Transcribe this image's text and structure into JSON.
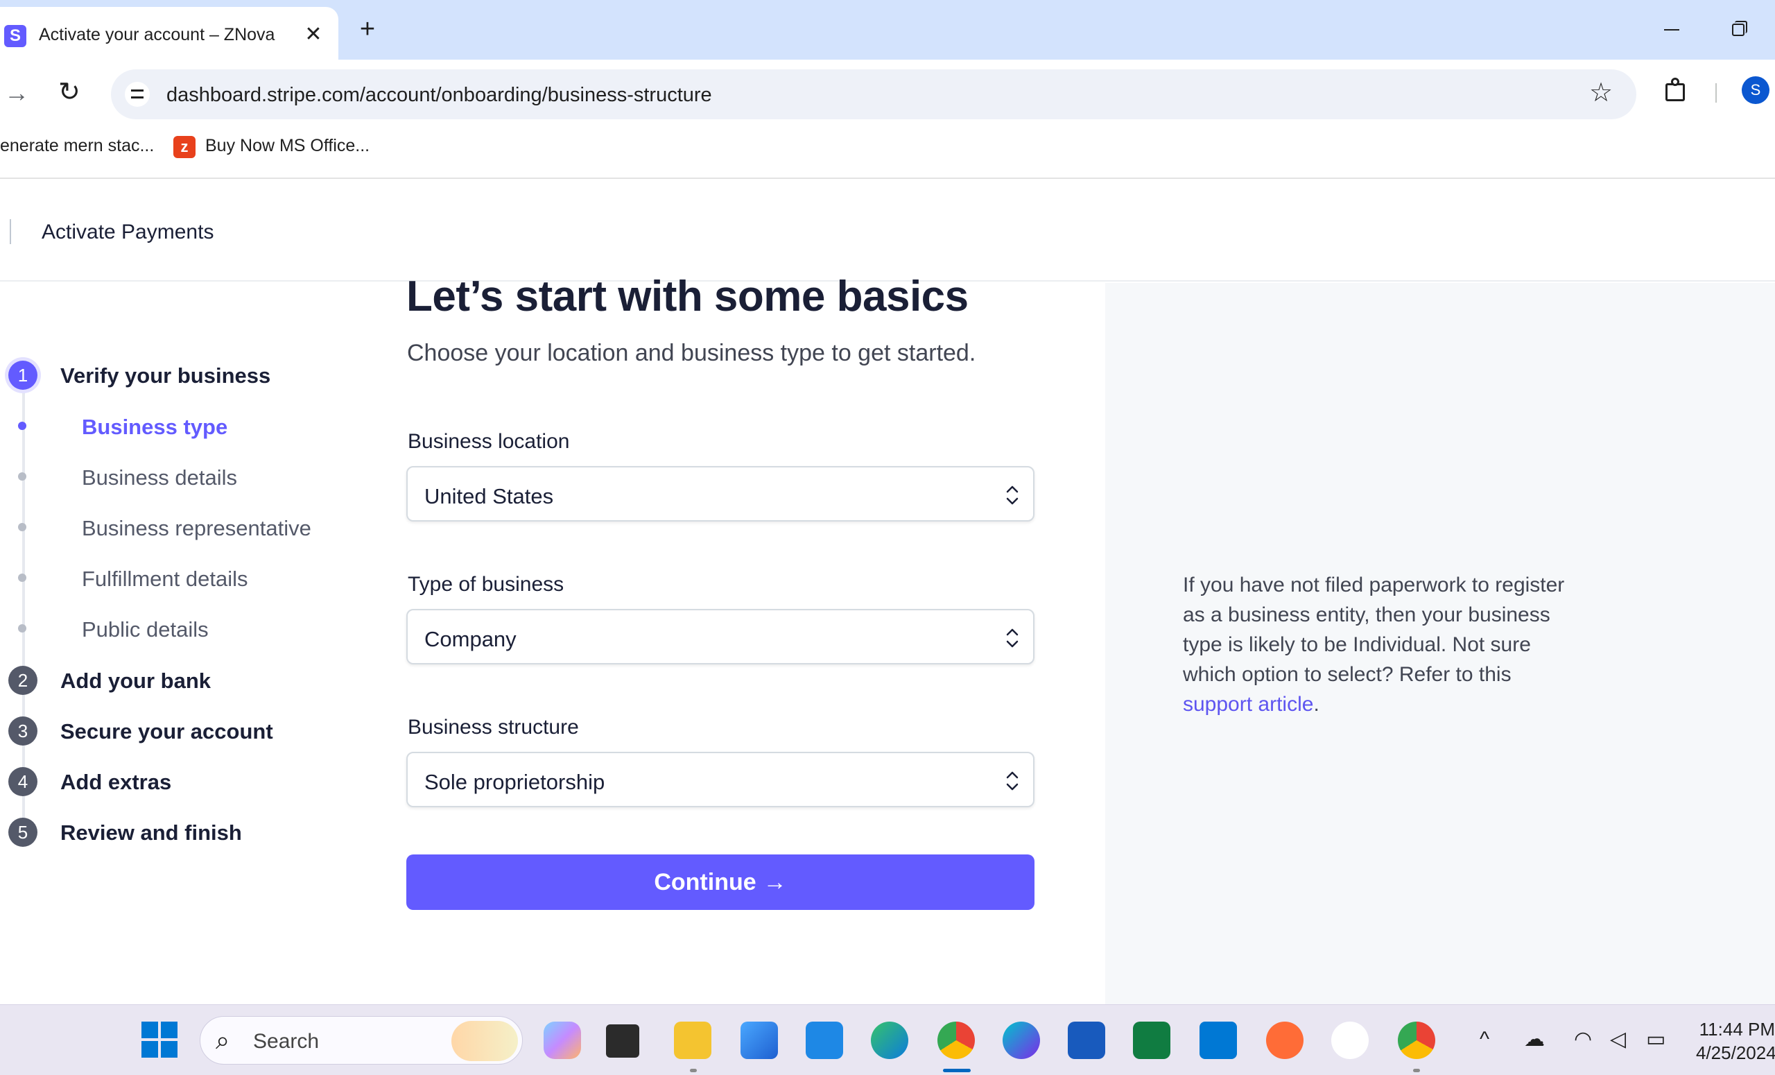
{
  "browser": {
    "tab_title": "Activate your account – ZNova",
    "tab_close": "✕",
    "new_tab": "+",
    "url": "dashboard.stripe.com/account/onboarding/business-structure",
    "bookmarks": [
      "enerate mern stac...",
      "Buy Now MS Office..."
    ],
    "profile_initial": "S"
  },
  "header": {
    "title": "Activate Payments"
  },
  "stepper": {
    "steps": [
      {
        "number": "1",
        "label": "Verify your business",
        "active": true
      },
      {
        "number": "2",
        "label": "Add your bank"
      },
      {
        "number": "3",
        "label": "Secure your account"
      },
      {
        "number": "4",
        "label": "Add extras"
      },
      {
        "number": "5",
        "label": "Review and finish"
      }
    ],
    "substeps": [
      {
        "label": "Business type",
        "active": true
      },
      {
        "label": "Business details"
      },
      {
        "label": "Business representative"
      },
      {
        "label": "Fulfillment details"
      },
      {
        "label": "Public details"
      }
    ]
  },
  "form": {
    "heading": "Let’s start with some basics",
    "subheading": "Choose your location and business type to get started.",
    "location_label": "Business location",
    "location_value": "United States",
    "type_label": "Type of business",
    "type_value": "Company",
    "structure_label": "Business structure",
    "structure_value": "Sole proprietorship",
    "continue_label": "Continue"
  },
  "help": {
    "text": "If you have not filed paperwork to register as a business entity, then your business type is likely to be Individual. Not sure which option to select? Refer to this ",
    "link": "support article",
    "end": "."
  },
  "taskbar": {
    "search_placeholder": "Search",
    "time": "11:44 PM",
    "date": "4/25/2024"
  },
  "colors": {
    "accent": "#635bff",
    "tab_strip": "#d3e3fd",
    "right_panel": "#f6f8fa"
  }
}
